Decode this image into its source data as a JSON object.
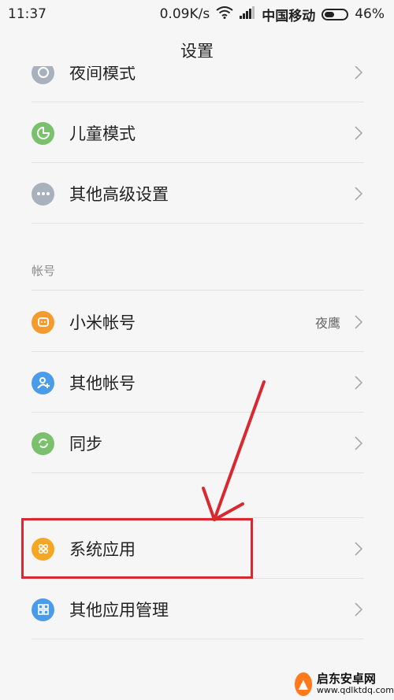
{
  "status_bar": {
    "time": "11:37",
    "speed": "0.09K/s",
    "carrier": "中国移动",
    "battery_percent": "46%",
    "battery_level": 0.46
  },
  "header": {
    "title": "设置"
  },
  "top_rows": [
    {
      "label": "夜间模式",
      "icon": "moon-icon",
      "color": "#a9b1bd"
    },
    {
      "label": "儿童模式",
      "icon": "child-mode-icon",
      "color": "#7bc16d"
    },
    {
      "label": "其他高级设置",
      "icon": "more-dots-icon",
      "color": "#a9b1bd"
    }
  ],
  "accounts_section": {
    "title": "帐号",
    "rows": [
      {
        "label": "小米帐号",
        "value": "夜鹰",
        "icon": "mi-account-icon",
        "color": "#f59a2e"
      },
      {
        "label": "其他帐号",
        "icon": "add-person-icon",
        "color": "#4a9ce8"
      },
      {
        "label": "同步",
        "icon": "sync-icon",
        "color": "#7bc16d"
      }
    ]
  },
  "apps_section": {
    "rows": [
      {
        "label": "系统应用",
        "icon": "system-apps-icon",
        "color": "#f5a623"
      },
      {
        "label": "其他应用管理",
        "icon": "app-grid-icon",
        "color": "#4a9ce8"
      }
    ]
  },
  "annotation": {
    "color": "#d7292f"
  },
  "watermark": {
    "name": "启东安卓网",
    "url": "www.qdlktdq.com"
  }
}
